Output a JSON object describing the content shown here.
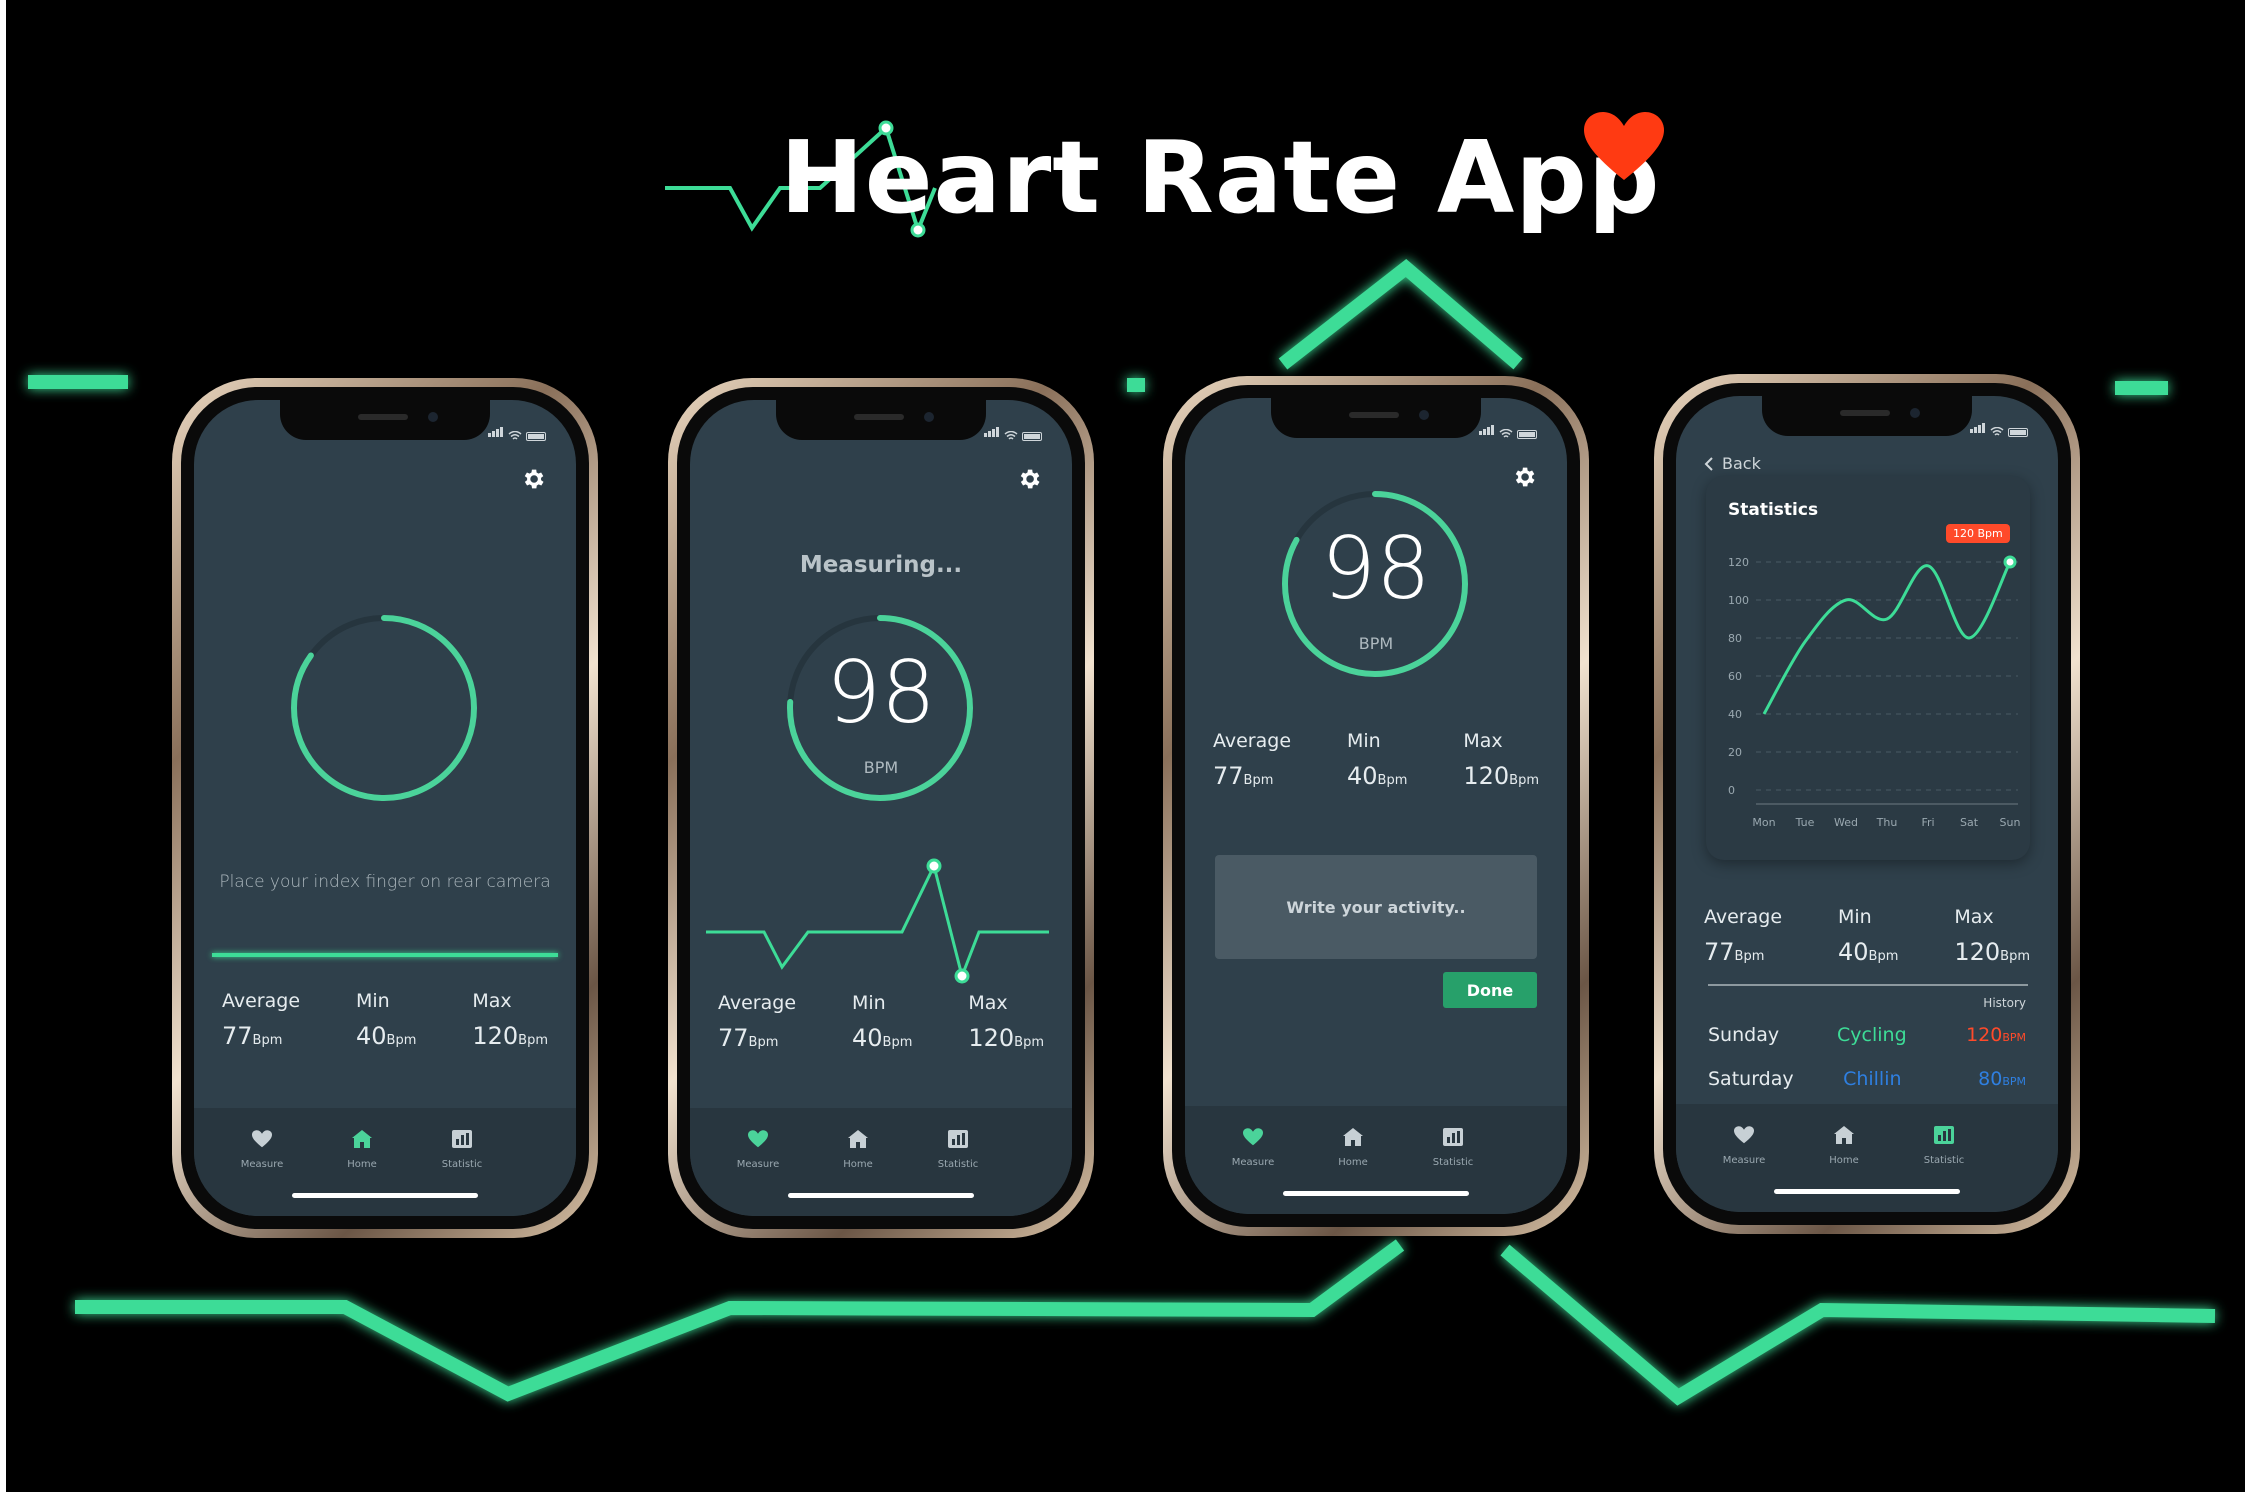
{
  "app_title": "Heart Rate App",
  "colors": {
    "accent": "#3ddc97",
    "ring": "#4bd39a",
    "heart": "#ff3a12",
    "screen": "#2f404b",
    "tabbar": "#28363f",
    "highlight_red": "#ff4a2a",
    "blue": "#2f7fe0"
  },
  "icons": {
    "settings": "gear-icon",
    "measure": "heart-icon",
    "home": "home-icon",
    "statistic": "bar-chart-icon",
    "back": "chevron-left-icon"
  },
  "tabs": {
    "measure": "Measure",
    "home": "Home",
    "statistic": "Statistic"
  },
  "screen1": {
    "instruction": "Place your index finger on rear camera",
    "stats": [
      {
        "label": "Average",
        "value": "77",
        "unit": "Bpm"
      },
      {
        "label": "Min",
        "value": "40",
        "unit": "Bpm"
      },
      {
        "label": "Max",
        "value": "120",
        "unit": "Bpm"
      }
    ]
  },
  "screen2": {
    "status": "Measuring...",
    "bpm": "98",
    "bpm_label": "BPM",
    "stats": [
      {
        "label": "Average",
        "value": "77",
        "unit": "Bpm"
      },
      {
        "label": "Min",
        "value": "40",
        "unit": "Bpm"
      },
      {
        "label": "Max",
        "value": "120",
        "unit": "Bpm"
      }
    ]
  },
  "screen3": {
    "bpm": "98",
    "bpm_label": "BPM",
    "stats": [
      {
        "label": "Average",
        "value": "77",
        "unit": "Bpm"
      },
      {
        "label": "Min",
        "value": "40",
        "unit": "Bpm"
      },
      {
        "label": "Max",
        "value": "120",
        "unit": "Bpm"
      }
    ],
    "activity_placeholder": "Write your activity..",
    "done_label": "Done"
  },
  "screen4": {
    "back_label": "Back",
    "card_title": "Statistics",
    "tooltip": "120 Bpm",
    "chart_data": {
      "type": "line",
      "categories": [
        "Mon",
        "Tue",
        "Wed",
        "Thu",
        "Fri",
        "Sat",
        "Sun"
      ],
      "values": [
        40,
        78,
        100,
        90,
        118,
        80,
        120
      ],
      "ylim": [
        0,
        120
      ],
      "yticks": [
        "120",
        "100",
        "80",
        "60",
        "40",
        "20",
        "0"
      ],
      "grid": true
    },
    "stats": [
      {
        "label": "Average",
        "value": "77",
        "unit": "Bpm"
      },
      {
        "label": "Min",
        "value": "40",
        "unit": "Bpm"
      },
      {
        "label": "Max",
        "value": "120",
        "unit": "Bpm"
      }
    ],
    "history_label": "History",
    "history": [
      {
        "day": "Sunday",
        "activity": "Cycling",
        "value": "120",
        "unit": "BPM"
      },
      {
        "day": "Saturday",
        "activity": "Chillin",
        "value": "80",
        "unit": "BPM"
      }
    ]
  }
}
